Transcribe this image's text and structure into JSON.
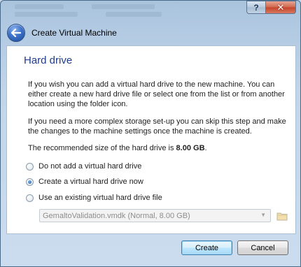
{
  "window": {
    "title": "Create Virtual Machine",
    "help_glyph": "?",
    "close_glyph": "✕"
  },
  "page": {
    "heading": "Hard drive",
    "paragraph1": "If you wish you can add a virtual hard drive to the new machine. You can either create a new hard drive file or select one from the list or from another location using the folder icon.",
    "paragraph2": "If you need a more complex storage set-up you can skip this step and make the changes to the machine settings once the machine is created.",
    "recommended_prefix": "The recommended size of the hard drive is ",
    "recommended_size": "8.00 GB",
    "recommended_suffix": "."
  },
  "options": [
    {
      "label": "Do not add a virtual hard drive",
      "selected": false
    },
    {
      "label": "Create a virtual hard drive now",
      "selected": true
    },
    {
      "label": "Use an existing virtual hard drive file",
      "selected": false
    }
  ],
  "existing_disk": {
    "value": "GemaltoValidation.vmdk (Normal, 8.00 GB)",
    "enabled": false
  },
  "buttons": {
    "create": "Create",
    "cancel": "Cancel"
  },
  "icons": {
    "back": "back-arrow-icon",
    "folder": "folder-icon",
    "dropdown": "chevron-down-icon"
  },
  "colors": {
    "heading": "#1f3c8f",
    "frame": "#c2d6ea",
    "close_button": "#c5442a",
    "default_button_border": "#3c7fb1"
  }
}
